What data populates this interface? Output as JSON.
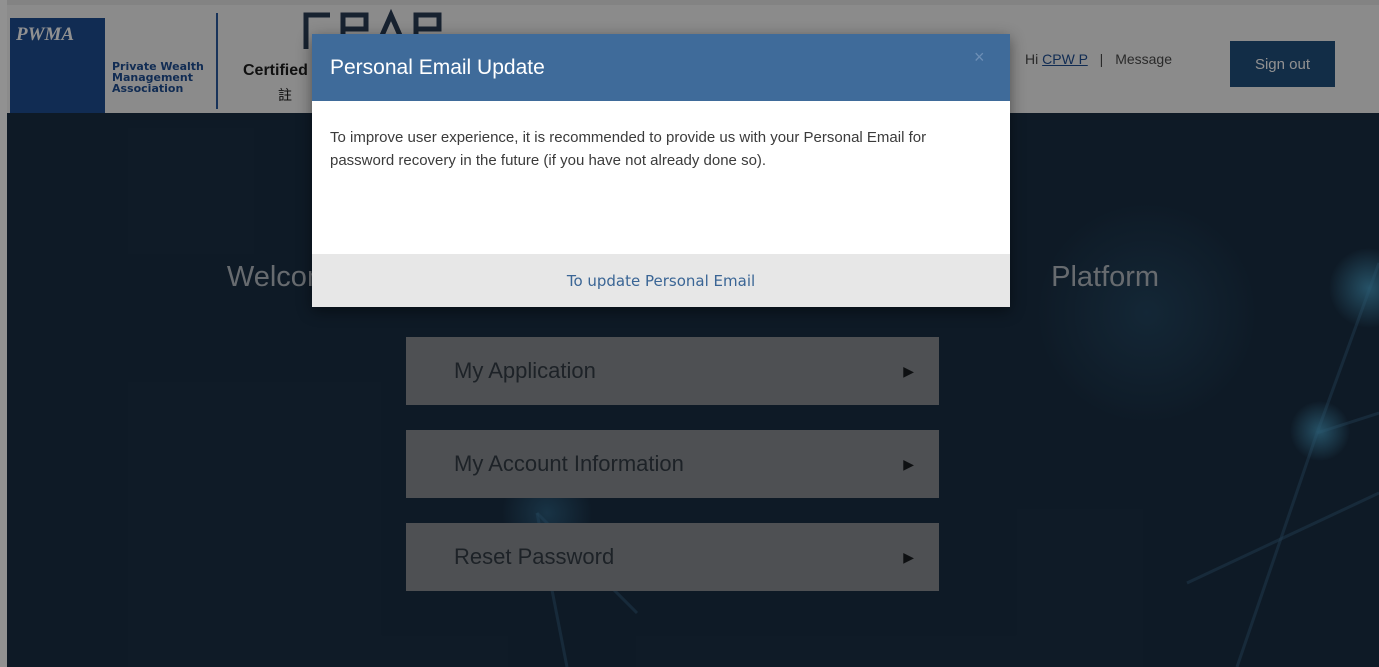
{
  "header": {
    "logo_mark": "PWMA",
    "logo_lines": [
      "Private Wealth",
      "Management",
      "Association"
    ],
    "cert_text": "Certified",
    "cert_sub": "註",
    "user_greeting": "Hi",
    "user_name": "CPW P",
    "separator": "|",
    "message_link": "Message",
    "signout_label": "Sign out"
  },
  "main": {
    "welcome_left": "Welcom",
    "welcome_right": "Platform",
    "menu": [
      {
        "label": "My Application",
        "arrow": "▶"
      },
      {
        "label": "My Account Information",
        "arrow": "▶"
      },
      {
        "label": "Reset Password",
        "arrow": "▶"
      }
    ]
  },
  "modal": {
    "title": "Personal Email Update",
    "close": "×",
    "body": "To improve user experience, it is recommended to provide us with your Personal Email for password recovery in the future (if you have not already done so).",
    "action_link": "To update Personal Email"
  },
  "colors": {
    "header_bg": "#f4f4f4",
    "brand_blue": "#1f4e93",
    "signout_bg": "#214f7e",
    "main_bg": "#1a2f44",
    "menu_btn_bg": "#8a8e92",
    "modal_header_bg": "#3f6b9a",
    "modal_footer_bg": "#e7e7e7"
  }
}
